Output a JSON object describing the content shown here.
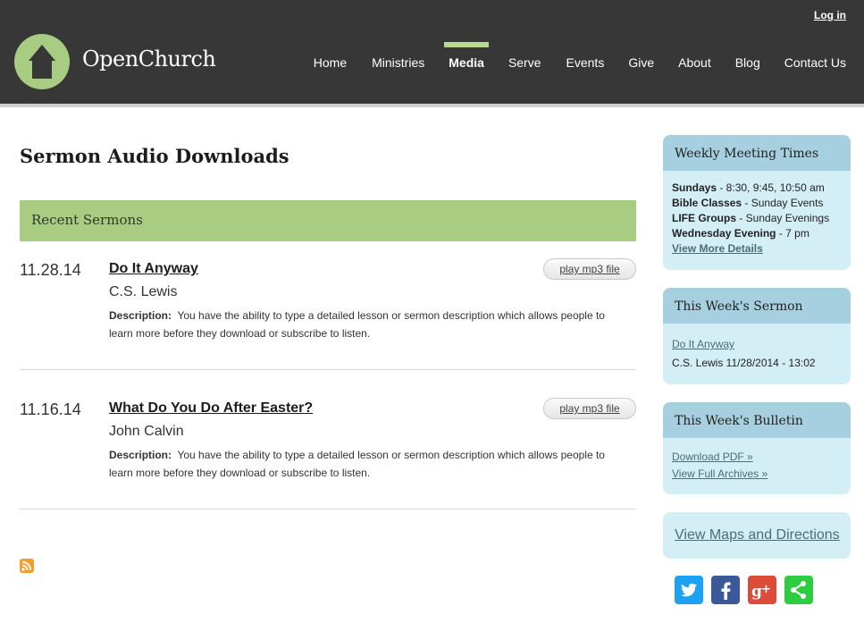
{
  "header": {
    "login_label": "Log in",
    "brand": "OpenChurch",
    "nav": [
      {
        "label": "Home",
        "active": false
      },
      {
        "label": "Ministries",
        "active": false
      },
      {
        "label": "Media",
        "active": true
      },
      {
        "label": "Serve",
        "active": false
      },
      {
        "label": "Events",
        "active": false
      },
      {
        "label": "Give",
        "active": false
      },
      {
        "label": "About",
        "active": false
      },
      {
        "label": "Blog",
        "active": false
      },
      {
        "label": "Contact Us",
        "active": false
      }
    ]
  },
  "main": {
    "title": "Sermon Audio Downloads",
    "section_title": "Recent Sermons",
    "sermons": [
      {
        "date": "11.28.14",
        "title": "Do It Anyway",
        "speaker": "C.S. Lewis",
        "desc_label": "Description:",
        "desc": "You have the ability to type a detailed lesson or sermon description which allows people to learn more before they download or subscribe to listen.",
        "play_label": "play mp3 file"
      },
      {
        "date": "11.16.14",
        "title": "What Do You Do After Easter?",
        "speaker": "John Calvin",
        "desc_label": "Description:",
        "desc": "You have the ability to type a detailed lesson or sermon description which allows people to learn more before they download or subscribe to listen.",
        "play_label": "play mp3 file"
      }
    ]
  },
  "sidebar": {
    "meeting": {
      "title": "Weekly Meeting Times",
      "rows": [
        {
          "label": "Sundays",
          "value": " - 8:30, 9:45, 10:50 am"
        },
        {
          "label": "Bible Classes",
          "value": " - Sunday Events"
        },
        {
          "label": "LIFE Groups",
          "value": " - Sunday Evenings"
        },
        {
          "label": "Wednesday Evening",
          "value": " - 7 pm"
        }
      ],
      "more_link": "View More Details"
    },
    "sermon": {
      "title": "This Week's Sermon",
      "link": "Do It Anyway",
      "meta": "C.S. Lewis 11/28/2014 - 13:02"
    },
    "bulletin": {
      "title": "This Week's Bulletin",
      "download_link": "Download PDF »",
      "archive_link": "View Full Archives »"
    },
    "maps_link": "View Maps and Directions",
    "social": [
      {
        "icon": "twitter-icon",
        "color": "#1da1f2"
      },
      {
        "icon": "facebook-icon",
        "color": "#3b5998"
      },
      {
        "icon": "google-plus-icon",
        "color": "#dd4b39"
      },
      {
        "icon": "share-icon",
        "color": "#2ecc40"
      }
    ]
  },
  "colors": {
    "header_bg": "#373737",
    "accent_green": "#a9cc83",
    "nav_active": "#b6d890",
    "sidebar_bg": "#d4eef5",
    "sidebar_head": "#a6cfdf",
    "link": "#4a6d76"
  }
}
